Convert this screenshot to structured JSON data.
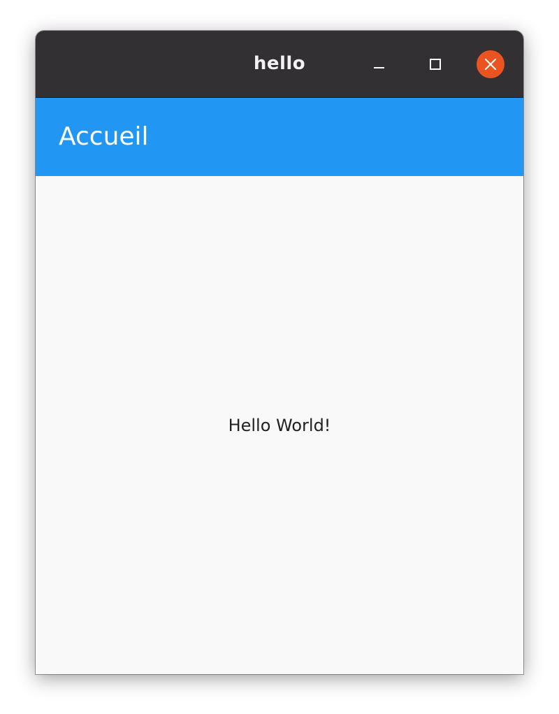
{
  "window": {
    "title": "hello",
    "controls": {
      "minimize_icon": "minimize-icon",
      "maximize_icon": "maximize-icon",
      "close_icon": "close-icon"
    },
    "titlebar_color": "#323032",
    "close_button_color": "#e95420"
  },
  "app_bar": {
    "title": "Accueil",
    "color": "#2196f3"
  },
  "body": {
    "text": "Hello World!",
    "background": "#f9f9f9"
  }
}
